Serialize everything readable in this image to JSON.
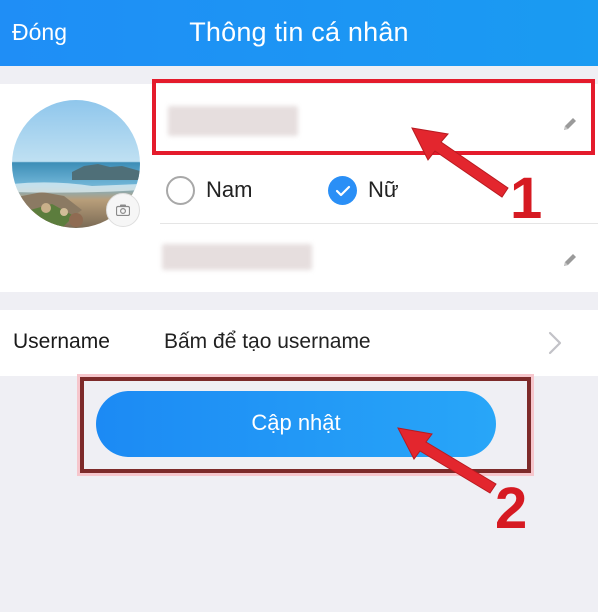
{
  "header": {
    "close_label": "Đóng",
    "title": "Thông tin cá nhân"
  },
  "profile": {
    "gender_options": [
      "Nam",
      "Nữ"
    ],
    "selected_gender": "Nữ"
  },
  "username_row": {
    "label": "Username",
    "value": "Bấm để tạo username"
  },
  "update_button": {
    "label": "Cập nhật"
  },
  "annotations": {
    "step1": "1",
    "step2": "2"
  },
  "colors": {
    "accent": "#1f8ef6",
    "annotation_red": "#e41b2c"
  },
  "icons": [
    "camera-icon",
    "pencil-icon",
    "check-icon",
    "chevron-right-icon"
  ]
}
